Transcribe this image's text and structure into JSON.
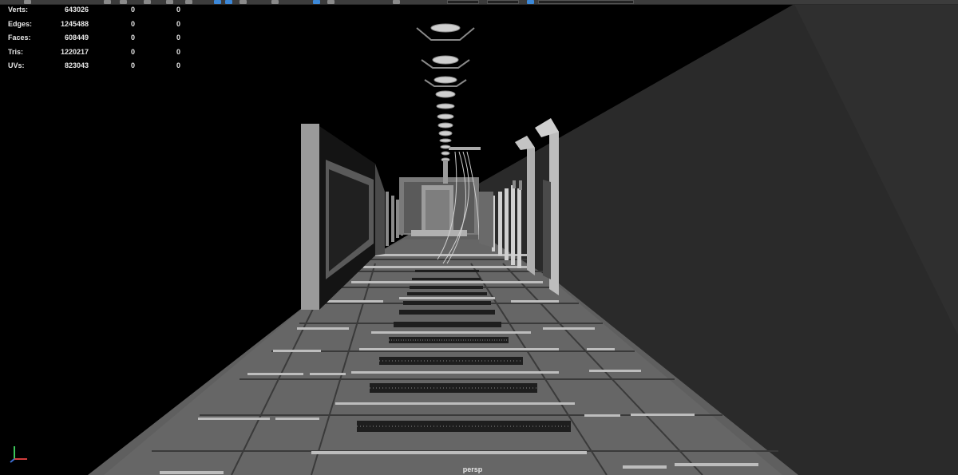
{
  "hud": {
    "rows": [
      {
        "label": "Verts:",
        "v1": "643026",
        "v2": "0",
        "v3": "0"
      },
      {
        "label": "Edges:",
        "v1": "1245488",
        "v2": "0",
        "v3": "0"
      },
      {
        "label": "Faces:",
        "v1": "608449",
        "v2": "0",
        "v3": "0"
      },
      {
        "label": "Tris:",
        "v1": "1220217",
        "v2": "0",
        "v3": "0"
      },
      {
        "label": "UVs:",
        "v1": "823043",
        "v2": "0",
        "v3": "0"
      }
    ]
  },
  "viewport": {
    "camera_label": "persp",
    "background": "#000000",
    "geometry_color": "#6e6e6e"
  },
  "axis_gizmo": {
    "x_color": "#d23c3c",
    "y_color": "#3cc85a",
    "z_color": "#3c6ed2"
  }
}
